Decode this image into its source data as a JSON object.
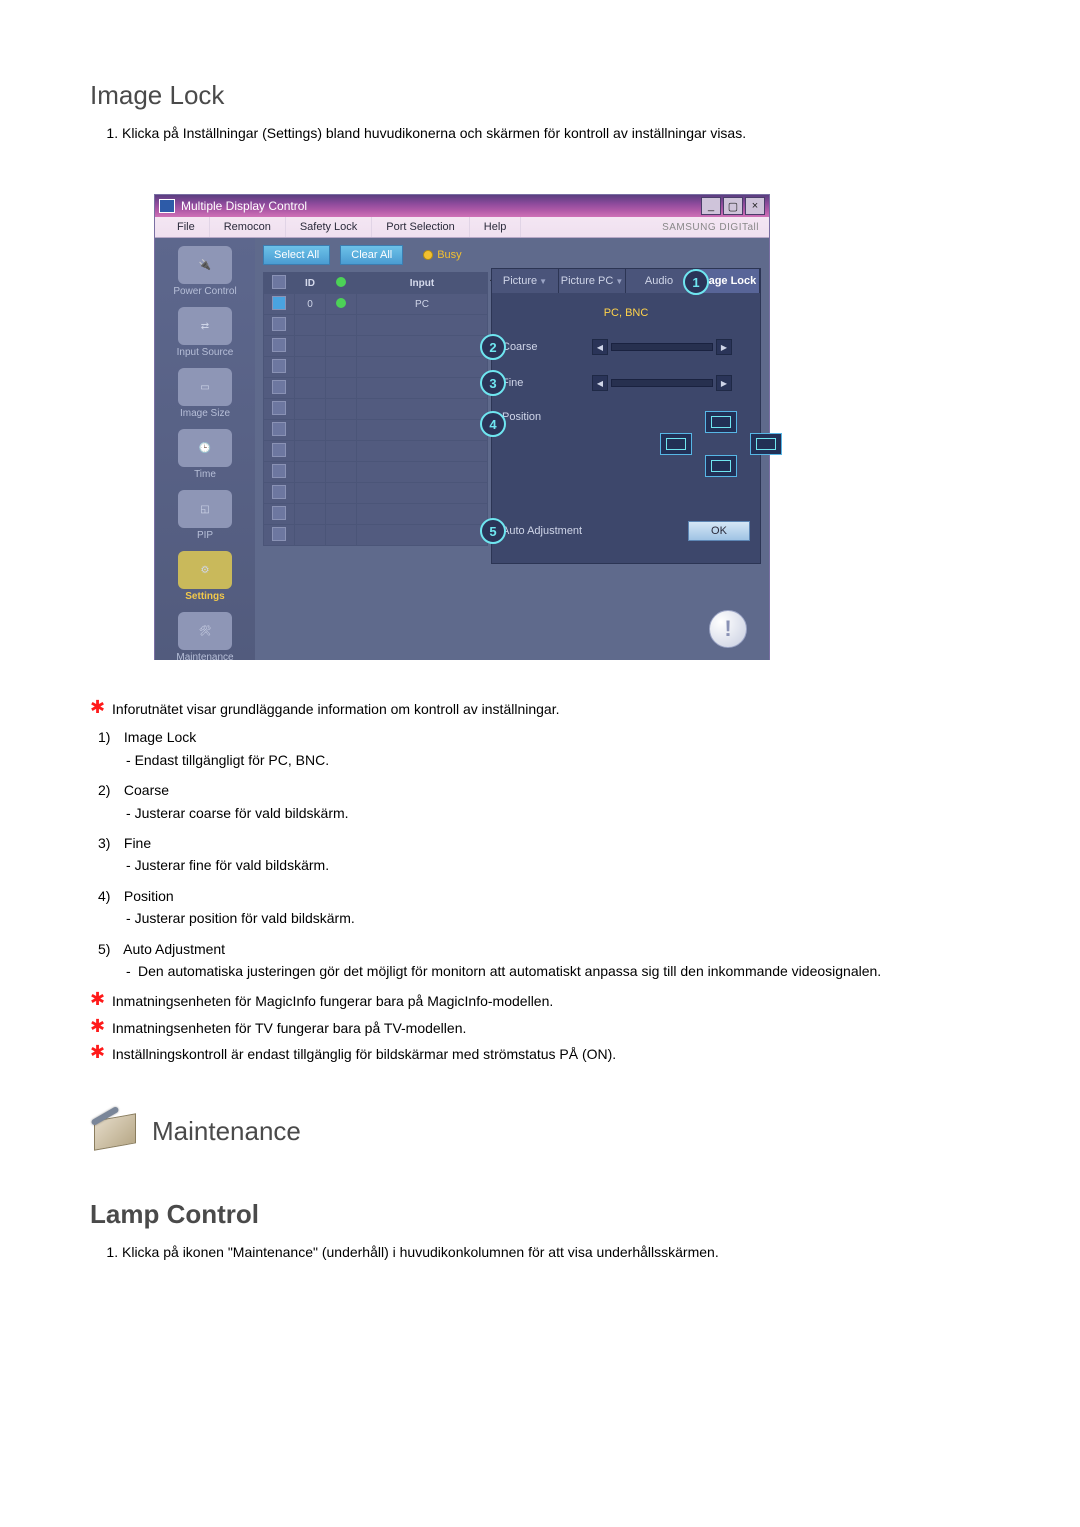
{
  "sections": {
    "imageLock": {
      "title": "Image Lock",
      "intro_item": "Klicka på Inställningar (Settings) bland huvudikonerna och skärmen för kontroll av inställningar visas."
    },
    "maintenance": {
      "title": "Maintenance"
    },
    "lampControl": {
      "title": "Lamp Control",
      "intro_item": "Klicka på ikonen \"Maintenance\" (underhåll) i huvudikonkolumnen för att visa underhållsskärmen."
    }
  },
  "screenshot": {
    "windowTitle": "Multiple Display Control",
    "brand": "SAMSUNG DIGITall",
    "menubar": [
      "File",
      "Remocon",
      "Safety Lock",
      "Port Selection",
      "Help"
    ],
    "toolbar": {
      "selectAll": "Select All",
      "clearAll": "Clear All",
      "busy": "Busy"
    },
    "sidebar": [
      {
        "label": "Power Control"
      },
      {
        "label": "Input Source"
      },
      {
        "label": "Image Size"
      },
      {
        "label": "Time"
      },
      {
        "label": "PIP"
      },
      {
        "label": "Settings",
        "selected": true
      },
      {
        "label": "Maintenance"
      }
    ],
    "grid": {
      "headers": {
        "chk": "☑",
        "id": "ID",
        "stat": "⦿",
        "input": "Input"
      },
      "row0": {
        "id": "0",
        "input": "PC"
      }
    },
    "panel": {
      "tabs": {
        "picture": "Picture",
        "picturePC": "Picture PC",
        "audio": "Audio",
        "imageLock": "Image Lock"
      },
      "subTitle": "PC, BNC",
      "coarse": "Coarse",
      "fine": "Fine",
      "position": "Position",
      "autoAdj": "Auto Adjustment",
      "ok": "OK",
      "callouts": {
        "c1": "1",
        "c2": "2",
        "c3": "3",
        "c4": "4",
        "c5": "5"
      }
    }
  },
  "notes": {
    "star_info": "Inforutnätet visar grundläggande information om kontroll av inställningar.",
    "items": [
      {
        "idx": "1)",
        "title": "Image Lock",
        "desc": "Endast tillgängligt för PC, BNC."
      },
      {
        "idx": "2)",
        "title": "Coarse",
        "desc": "Justerar coarse för vald bildskärm."
      },
      {
        "idx": "3)",
        "title": "Fine",
        "desc": "Justerar fine för vald bildskärm."
      },
      {
        "idx": "4)",
        "title": "Position",
        "desc": "Justerar position för vald bildskärm."
      },
      {
        "idx": "5)",
        "title": "Auto Adjustment",
        "desc": "Den automatiska justeringen gör det möjligt för monitorn att automatiskt anpassa sig till den inkommande videosignalen."
      }
    ],
    "star_magic": "Inmatningsenheten för MagicInfo fungerar bara på MagicInfo-modellen.",
    "star_tv": "Inmatningsenheten för TV fungerar bara på TV-modellen.",
    "star_power": "Inställningskontroll är endast tillgänglig för bildskärmar med strömstatus PÅ (ON)."
  }
}
